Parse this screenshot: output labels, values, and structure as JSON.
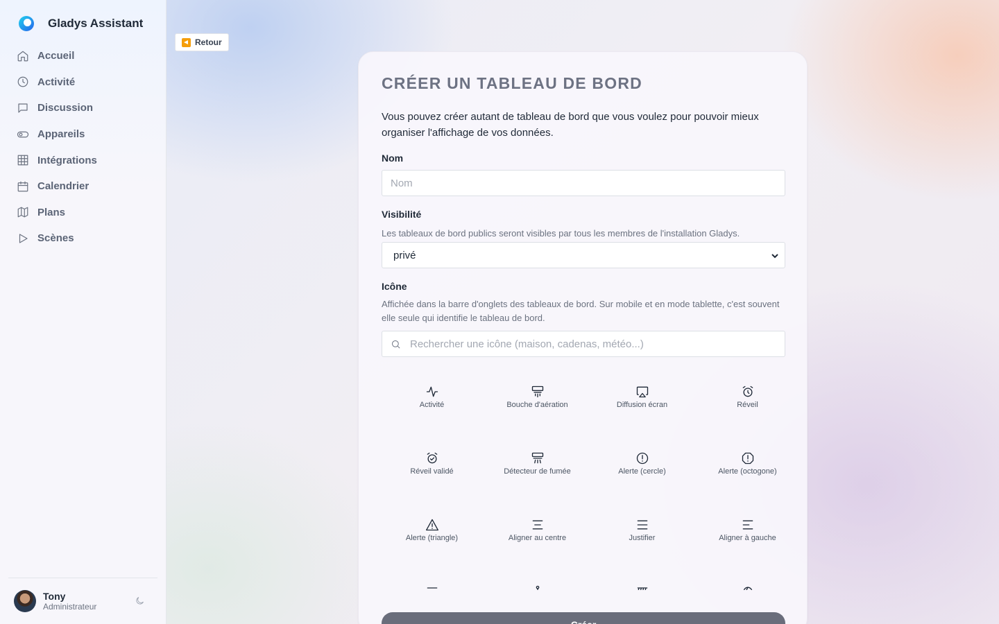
{
  "app": {
    "name": "Gladys Assistant"
  },
  "sidebar": {
    "items": [
      {
        "label": "Accueil",
        "icon": "home-icon"
      },
      {
        "label": "Activité",
        "icon": "clock-icon"
      },
      {
        "label": "Discussion",
        "icon": "message-icon"
      },
      {
        "label": "Appareils",
        "icon": "toggle-icon"
      },
      {
        "label": "Intégrations",
        "icon": "grid-icon"
      },
      {
        "label": "Calendrier",
        "icon": "calendar-icon"
      },
      {
        "label": "Plans",
        "icon": "map-icon"
      },
      {
        "label": "Scènes",
        "icon": "play-icon"
      }
    ],
    "user": {
      "name": "Tony",
      "role": "Administrateur"
    }
  },
  "back": {
    "label": "Retour"
  },
  "form": {
    "title": "CRÉER UN TABLEAU DE BORD",
    "intro": "Vous pouvez créer autant de tableau de bord que vous voulez pour pouvoir mieux organiser l'affichage de vos données.",
    "name": {
      "label": "Nom",
      "placeholder": "Nom",
      "value": ""
    },
    "visibility": {
      "label": "Visibilité",
      "hint": "Les tableaux de bord publics seront visibles par tous les membres de l'installation Gladys.",
      "selected": "privé"
    },
    "icon": {
      "label": "Icône",
      "hint": "Affichée dans la barre d'onglets des tableaux de bord. Sur mobile et en mode tablette, c'est souvent elle seule qui identifie le tableau de bord.",
      "search_placeholder": "Rechercher une icône (maison, cadenas, météo...)"
    },
    "icons": [
      {
        "label": "Activité",
        "icon": "activity-icon"
      },
      {
        "label": "Bouche d'aération",
        "icon": "air-vent-icon"
      },
      {
        "label": "Diffusion écran",
        "icon": "airplay-icon"
      },
      {
        "label": "Réveil",
        "icon": "alarm-clock-icon"
      },
      {
        "label": "Réveil validé",
        "icon": "alarm-clock-check-icon"
      },
      {
        "label": "Détecteur de fumée",
        "icon": "smoke-detector-icon"
      },
      {
        "label": "Alerte (cercle)",
        "icon": "alert-circle-icon"
      },
      {
        "label": "Alerte (octogone)",
        "icon": "alert-octagon-icon"
      },
      {
        "label": "Alerte (triangle)",
        "icon": "alert-triangle-icon"
      },
      {
        "label": "Aligner au centre",
        "icon": "align-center-icon"
      },
      {
        "label": "Justifier",
        "icon": "align-justify-icon"
      },
      {
        "label": "Aligner à gauche",
        "icon": "align-left-icon"
      },
      {
        "label": "",
        "icon": "minus-icon"
      },
      {
        "label": "",
        "icon": "anchor-icon"
      },
      {
        "label": "",
        "icon": "heater-icon"
      },
      {
        "label": "",
        "icon": "aperture-icon"
      }
    ],
    "submit_label": "Créer"
  }
}
